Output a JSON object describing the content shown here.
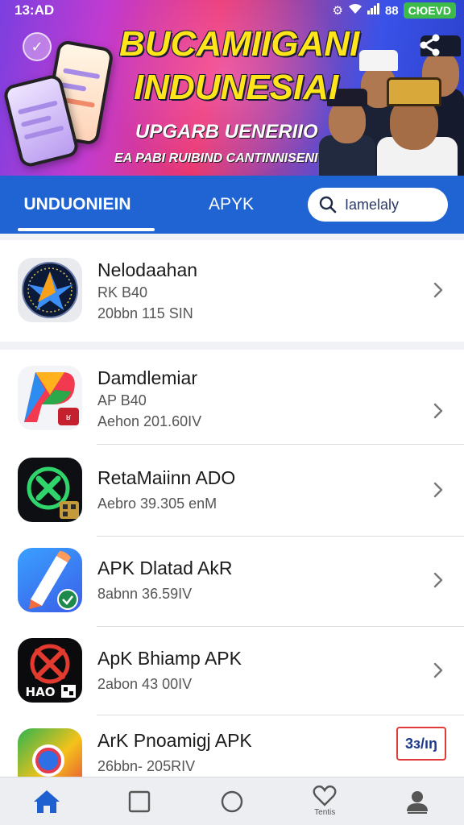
{
  "status_bar": {
    "time": "13:AD",
    "icons_text": "⚙ 📶",
    "network_text": "88",
    "battery_text": "CЮEVD",
    "colors": {
      "battery": "#3dbb4a"
    }
  },
  "banner": {
    "title_line1": "BUCAMIIGANI",
    "title_line2": "INDUNESIAI",
    "subtitle": "UPGARB UENERIIO",
    "tagline": "EA PABI RUIBIND CANTINNISENI",
    "share_icon": "share-icon",
    "colors": {
      "title": "#ffe51a",
      "accent": "#1f64d2"
    }
  },
  "tabs": [
    {
      "label": "UNDUONIEIN",
      "active": true
    },
    {
      "label": "APYK",
      "active": false
    }
  ],
  "search": {
    "value": "Iamelaly",
    "icon": "search-icon"
  },
  "featured": {
    "name": "Nelodaahan",
    "line1": "RK B40",
    "line2": "20bbn 115 SIN"
  },
  "apps": [
    {
      "name": "Damdlemiar",
      "line1": "AP B40",
      "line2": "Aehon 201.60IV"
    },
    {
      "name": "RetaMaiinn ADO",
      "line1": "",
      "line2": "Aebro 39.305 enM"
    },
    {
      "name": "APK Dlatad AkR",
      "line1": "",
      "line2": "8abnn 36.59IV"
    },
    {
      "name": "ApK Bhiamp APK",
      "line1": "",
      "line2": "2abon 43 00IV"
    },
    {
      "name": "ArK Pnoamigj APK",
      "line1": "",
      "line2": "26bbn- 205RIV",
      "badge": "3ɜ/ıŋ"
    }
  ],
  "bottom_nav": [
    {
      "icon": "home-icon",
      "label": "",
      "active": true
    },
    {
      "icon": "square-icon",
      "label": "",
      "active": false
    },
    {
      "icon": "circle-icon",
      "label": "",
      "active": false
    },
    {
      "icon": "heart-icon",
      "label": "Tentis",
      "active": false
    },
    {
      "icon": "profile-icon",
      "label": "",
      "active": false
    }
  ]
}
